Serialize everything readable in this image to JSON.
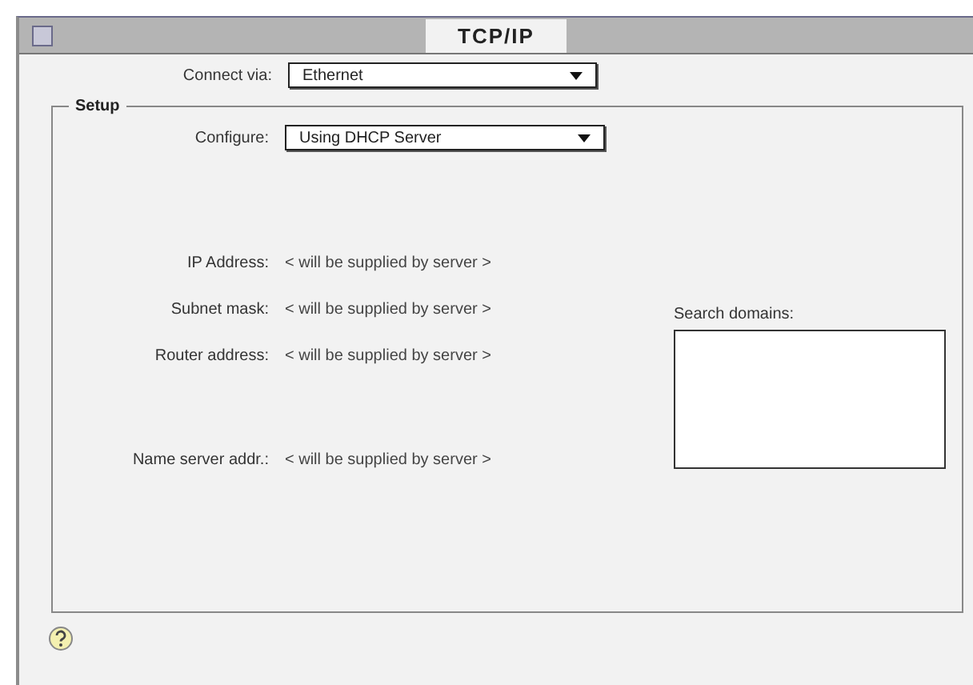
{
  "window": {
    "title": "TCP/IP"
  },
  "connect_via": {
    "label": "Connect via:",
    "value": "Ethernet"
  },
  "setup": {
    "title": "Setup",
    "configure": {
      "label": "Configure:",
      "value": "Using DHCP Server"
    },
    "fields": [
      {
        "label": "IP Address:",
        "value": "< will be supplied by server >"
      },
      {
        "label": "Subnet mask:",
        "value": "< will be supplied by server >"
      },
      {
        "label": "Router address:",
        "value": "< will be supplied by server >"
      }
    ],
    "name_server": {
      "label": "Name server addr.:",
      "value": "< will be supplied by server >"
    },
    "search_domains": {
      "label": "Search domains:"
    }
  }
}
